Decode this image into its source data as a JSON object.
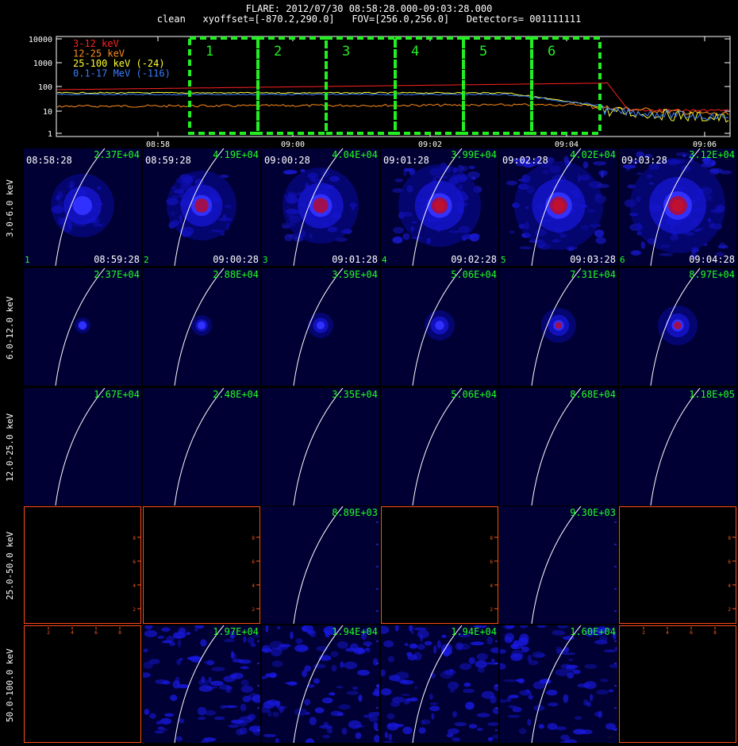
{
  "header": {
    "line1": "FLARE: 2012/07/30 08:58:28.000-09:03:28.000",
    "line2": "clean   xyoffset=[-870.2,290.0]   FOV=[256.0,256.0]   Detectors= 001111111"
  },
  "lightcurve": {
    "legend": [
      {
        "label": "3-12 keV",
        "color": "#ff2020"
      },
      {
        "label": "12-25 keV",
        "color": "#ff8c1a"
      },
      {
        "label": "25-100 keV (-24)",
        "color": "#ffff33"
      },
      {
        "label": "0.1-17 MeV (-116)",
        "color": "#3a7bff"
      }
    ],
    "yticks": [
      "10000",
      "1000",
      "100",
      "10",
      "1"
    ],
    "xticks": [
      "08:58",
      "09:00",
      "09:02",
      "09:04",
      "09:06"
    ],
    "interval_labels": [
      "1",
      "2",
      "3",
      "4",
      "5",
      "6"
    ],
    "box_color": "#22ee22"
  },
  "row_labels": [
    "3.0-6.0 keV",
    "6.0-12.0 keV",
    "12.0-25.0 keV",
    "25.0-50.0 keV",
    "50.0-100.0 keV"
  ],
  "panels": [
    [
      {
        "start": "08:58:28",
        "end": "08:59:28",
        "idx": "1",
        "max": "2.37E+04"
      },
      {
        "start": "08:59:28",
        "end": "09:00:28",
        "idx": "2",
        "max": "4.19E+04"
      },
      {
        "start": "09:00:28",
        "end": "09:01:28",
        "idx": "3",
        "max": "4.04E+04"
      },
      {
        "start": "09:01:28",
        "end": "09:02:28",
        "idx": "4",
        "max": "3.99E+04"
      },
      {
        "start": "09:02:28",
        "end": "09:03:28",
        "idx": "5",
        "max": "4.02E+04"
      },
      {
        "start": "09:03:28",
        "end": "09:04:28",
        "idx": "6",
        "max": "3.12E+04"
      }
    ],
    [
      {
        "max": "2.37E+04"
      },
      {
        "max": "2.88E+04"
      },
      {
        "max": "3.59E+04"
      },
      {
        "max": "5.06E+04"
      },
      {
        "max": "7.31E+04"
      },
      {
        "max": "8.97E+04"
      }
    ],
    [
      {
        "max": "1.67E+04"
      },
      {
        "max": "2.48E+04"
      },
      {
        "max": "3.35E+04"
      },
      {
        "max": "5.06E+04"
      },
      {
        "max": "8.68E+04"
      },
      {
        "max": "1.18E+05"
      }
    ],
    [
      {
        "max": ""
      },
      {
        "max": ""
      },
      {
        "max": "8.89E+03"
      },
      {
        "max": ""
      },
      {
        "max": "9.30E+03"
      },
      {
        "max": ""
      }
    ],
    [
      {
        "max": ""
      },
      {
        "max": "1.97E+04"
      },
      {
        "max": "1.94E+04"
      },
      {
        "max": "1.94E+04"
      },
      {
        "max": "1.60E+04"
      },
      {
        "max": ""
      }
    ]
  ],
  "empty_axis_ticks": [
    "2",
    "4",
    "6",
    "8"
  ]
}
